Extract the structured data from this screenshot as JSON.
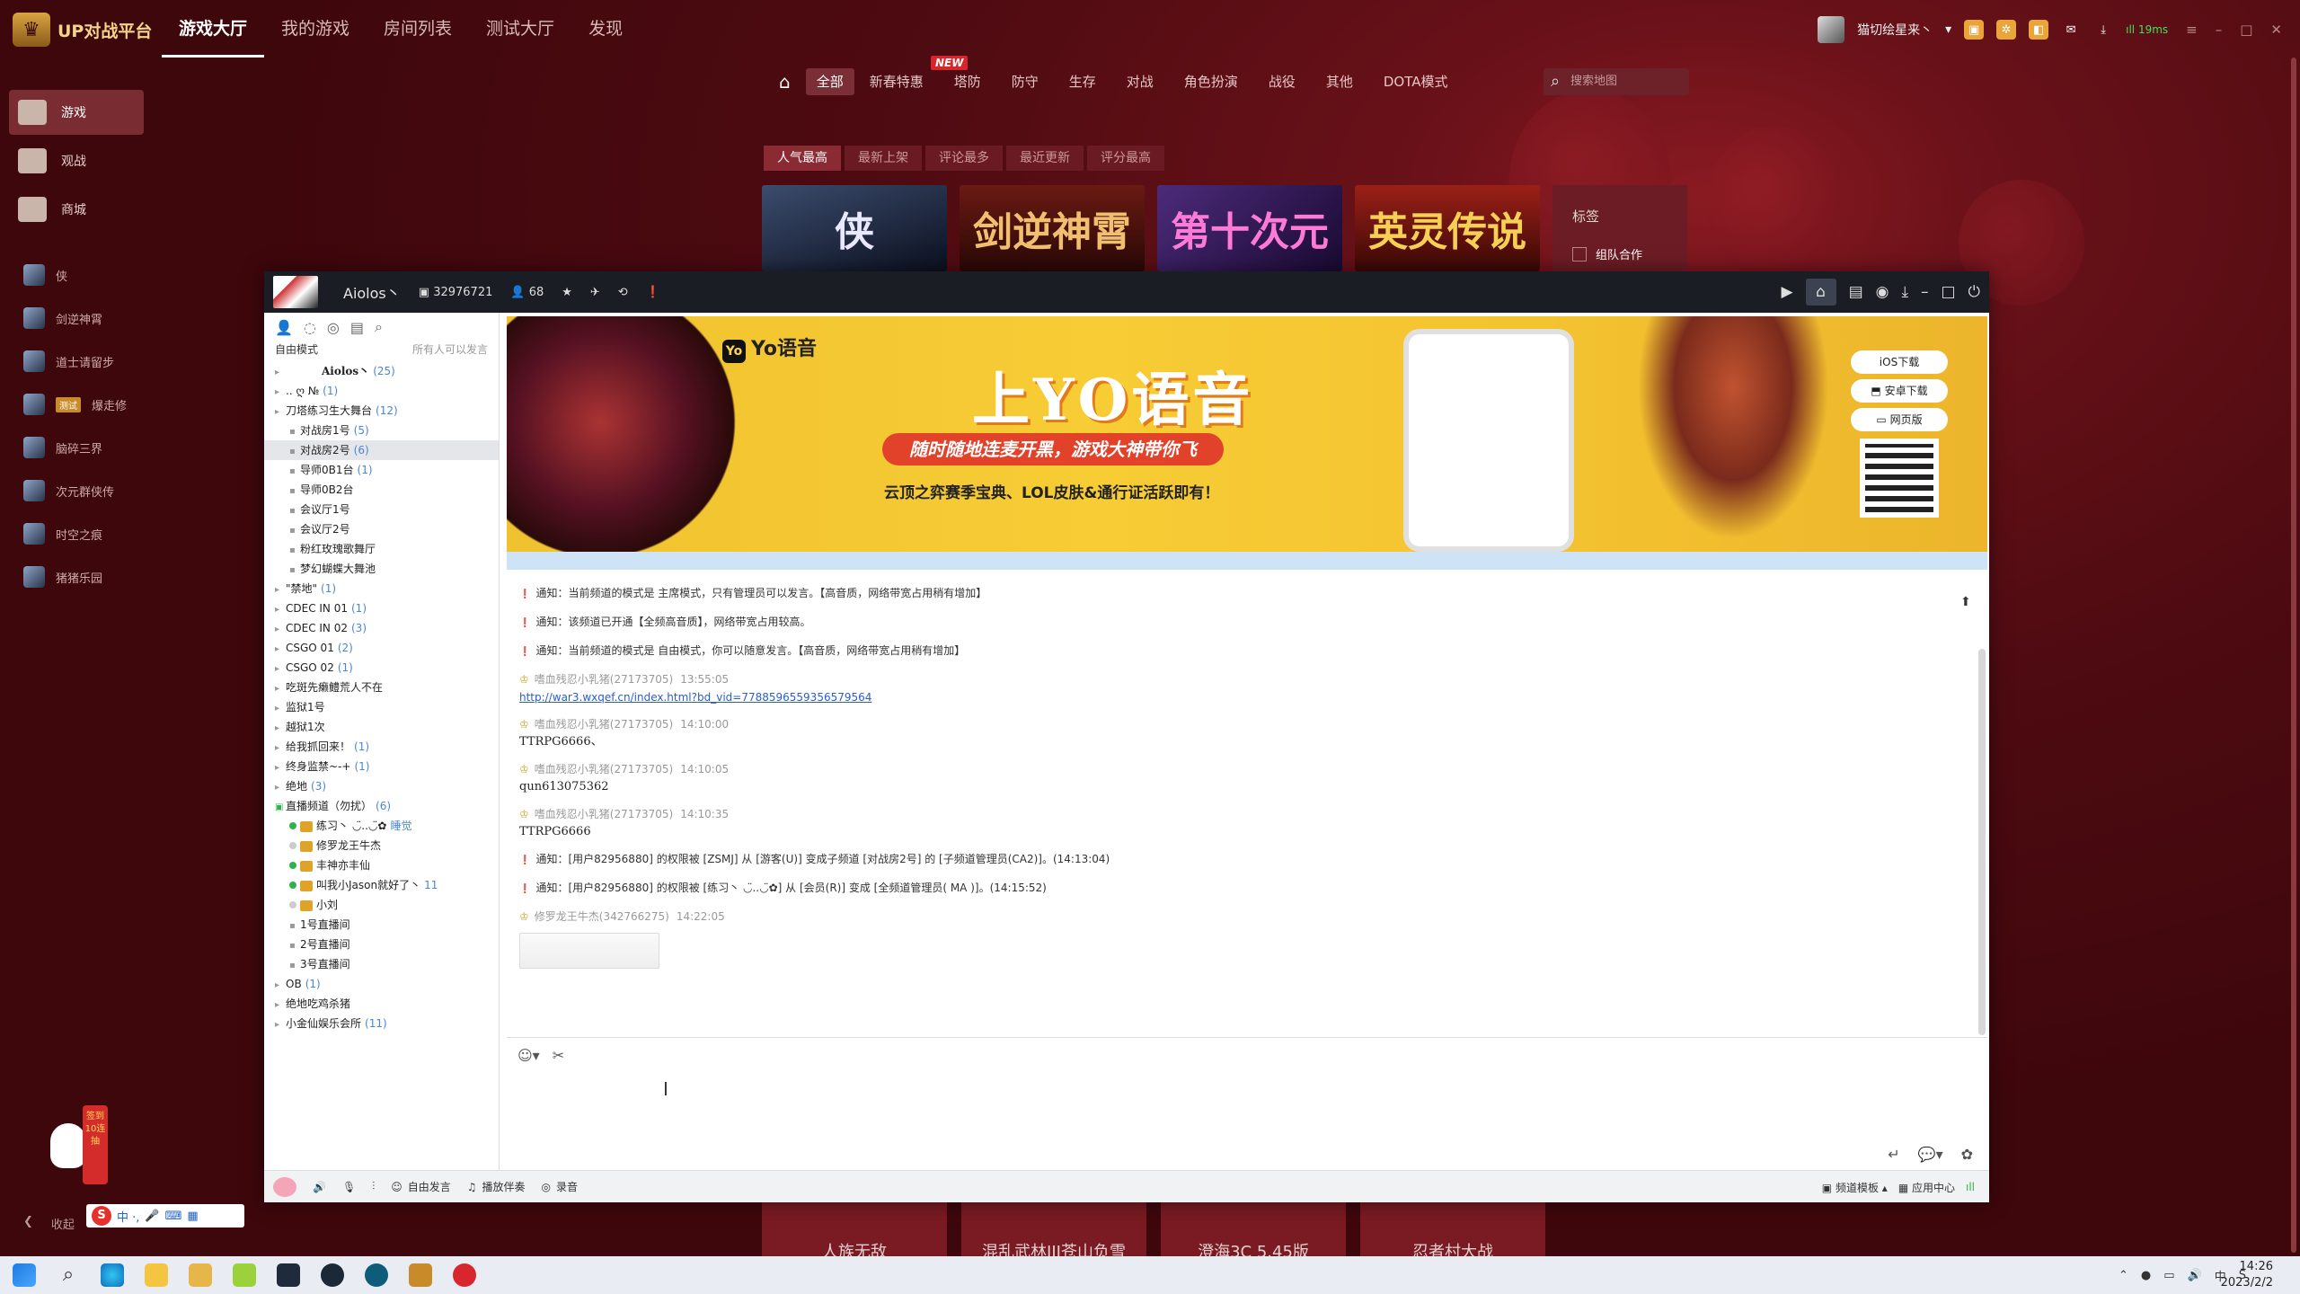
{
  "app": {
    "name": "UP对战平台"
  },
  "nav": [
    "游戏大厅",
    "我的游戏",
    "房间列表",
    "测试大厅",
    "发现"
  ],
  "nav_active": 0,
  "user": {
    "name": "猫切绘星来丶",
    "ping": "19ms"
  },
  "sidebar": {
    "main": [
      {
        "label": "游戏"
      },
      {
        "label": "观战"
      },
      {
        "label": "商城"
      }
    ],
    "games": [
      {
        "label": "侠"
      },
      {
        "label": "剑逆神霄"
      },
      {
        "label": "道士请留步"
      },
      {
        "label": "爆走修",
        "badge": "测试"
      },
      {
        "label": "脑碎三界"
      },
      {
        "label": "次元群侠传"
      },
      {
        "label": "时空之痕"
      },
      {
        "label": "猪猪乐园"
      }
    ],
    "collapse": "收起",
    "float_text": "签到10连抽"
  },
  "categories": [
    "全部",
    "新春特惠",
    "塔防",
    "防守",
    "生存",
    "对战",
    "角色扮演",
    "战役",
    "其他",
    "DOTA模式"
  ],
  "new_badge": "NEW",
  "search_placeholder": "搜索地图",
  "sorts": [
    "人气最高",
    "最新上架",
    "评论最多",
    "最近更新",
    "评分最高"
  ],
  "banners": [
    "侠",
    "剑逆神霄",
    "第十次元",
    "英灵传说"
  ],
  "tagbox": {
    "title": "标签",
    "option": "组队合作"
  },
  "bottom_banners": [
    "人族无敌",
    "混乱武林III苍山负雪",
    "澄海3C 5.45版",
    "忍者村大战"
  ],
  "voice": {
    "channel_name": "Aiolos丶",
    "channel_id": "32976721",
    "online": "68",
    "mode": "自由模式",
    "speak_all": "所有人可以发言",
    "tree": [
      {
        "label": "Aiolos丶",
        "count": "(25)",
        "level": 0,
        "type": "root"
      },
      {
        "label": "..  ღ  №",
        "count": "(1)",
        "level": 0
      },
      {
        "label": "刀塔练习生大舞台",
        "count": "(12)",
        "level": 0,
        "open": true
      },
      {
        "label": "对战房1号",
        "count": "(5)",
        "level": 1
      },
      {
        "label": "对战房2号",
        "count": "(6)",
        "level": 1,
        "selected": true
      },
      {
        "label": "导师0B1台",
        "count": "(1)",
        "level": 1
      },
      {
        "label": "导师0B2台",
        "count": "",
        "level": 1
      },
      {
        "label": "会议厅1号",
        "count": "",
        "level": 1
      },
      {
        "label": "会议厅2号",
        "count": "",
        "level": 1
      },
      {
        "label": "粉红玫瑰歌舞厅",
        "count": "",
        "level": 1
      },
      {
        "label": "梦幻蝴蝶大舞池",
        "count": "",
        "level": 1
      },
      {
        "label": "\"禁地\"",
        "count": "(1)",
        "level": 0
      },
      {
        "label": "CDEC IN 01",
        "count": "(1)",
        "level": 0
      },
      {
        "label": "CDEC IN 02",
        "count": "(3)",
        "level": 0
      },
      {
        "label": "CSGO 01",
        "count": "(2)",
        "level": 0
      },
      {
        "label": "CSGO 02",
        "count": "(1)",
        "level": 0
      },
      {
        "label": "吃斑先癞鳢荒人不在",
        "count": "",
        "level": 0
      },
      {
        "label": "监狱1号",
        "count": "",
        "level": 0
      },
      {
        "label": "越狱1次",
        "count": "",
        "level": 0
      },
      {
        "label": "给我抓回来！",
        "count": "(1)",
        "level": 0
      },
      {
        "label": "终身监禁~-+",
        "count": "(1)",
        "level": 0
      },
      {
        "label": "绝地",
        "count": "(3)",
        "level": 0
      },
      {
        "label": "直播频道（勿扰）",
        "count": "(6)",
        "level": 0,
        "live": true
      },
      {
        "label": "练习丶 ◡̈..◡̈✿",
        "count": "睡觉",
        "level": 1,
        "user": true,
        "online": true
      },
      {
        "label": "修罗龙王牛杰",
        "count": "",
        "level": 1,
        "user": true
      },
      {
        "label": "丰神亦丰仙",
        "count": "",
        "level": 1,
        "user": true,
        "online": true
      },
      {
        "label": "叫我小Jason就好了丶",
        "count": "11",
        "level": 1,
        "user": true,
        "online": true
      },
      {
        "label": "小刘",
        "count": "",
        "level": 1,
        "user": true
      },
      {
        "label": "1号直播间",
        "count": "",
        "level": 1
      },
      {
        "label": "2号直播间",
        "count": "",
        "level": 1
      },
      {
        "label": "3号直播间",
        "count": "",
        "level": 1
      },
      {
        "label": "OB",
        "count": "(1)",
        "level": 0
      },
      {
        "label": "绝地吃鸡杀猪",
        "count": "",
        "level": 0
      },
      {
        "label": "小金仙娱乐会所",
        "count": "(11)",
        "level": 0
      }
    ],
    "ad": {
      "logo": "Yo语音",
      "title": "上YO语音",
      "subtitle": "随时随地连麦开黑，游戏大神带你飞",
      "desc": "云顶之弈赛季宝典、LOL皮肤&通行证活跃即有！",
      "ios": "iOS下载",
      "android": "安卓下载",
      "web": "网页版"
    },
    "messages": [
      {
        "type": "notice",
        "text": "通知：当前频道的模式是 主席模式，只有管理员可以发言。【高音质，网络带宽占用稍有增加】"
      },
      {
        "type": "notice",
        "text": "通知：该频道已开通【全频高音质】，网络带宽占用较高。"
      },
      {
        "type": "notice",
        "text": "通知：当前频道的模式是 自由模式，你可以随意发言。【高音质，网络带宽占用稍有增加】"
      },
      {
        "type": "chat",
        "user": "嗜血残忍小乳猪(27173705)",
        "time": "13:55:05",
        "link": "http://war3.wxqef.cn/index.html?bd_vid=7788596559356579564"
      },
      {
        "type": "chat",
        "user": "嗜血残忍小乳猪(27173705)",
        "time": "14:10:00",
        "text": "TTRPG6666、"
      },
      {
        "type": "chat",
        "user": "嗜血残忍小乳猪(27173705)",
        "time": "14:10:05",
        "text": "qun613075362"
      },
      {
        "type": "chat",
        "user": "嗜血残忍小乳猪(27173705)",
        "time": "14:10:35",
        "text": "TTRPG6666"
      },
      {
        "type": "notice",
        "text": "通知：[用户82956880] 的权限被 [ZSMJ] 从 [游客(U)] 变成子频道 [对战房2号] 的 [子频道管理员(CA2)]。(14:13:04)"
      },
      {
        "type": "notice",
        "text": "通知：[用户82956880] 的权限被 [练习丶 ◡̈..◡̈✿] 从 [会员(R)] 变成 [全频道管理员( MA )]。(14:15:52)"
      },
      {
        "type": "chat",
        "user": "修罗龙王牛杰(342766275)",
        "time": "14:22:05",
        "image": true
      }
    ],
    "bottom": [
      "自由发言",
      "播放伴奏",
      "录音"
    ],
    "bottom_right": [
      "频道模板",
      "应用中心"
    ]
  },
  "taskbar": {
    "time": "14:26",
    "date": "2023/2/2"
  }
}
